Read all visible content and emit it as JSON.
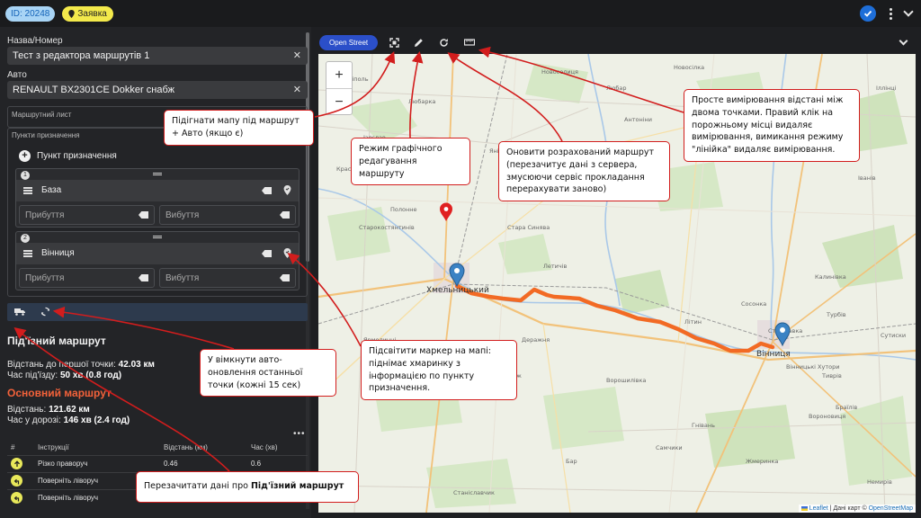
{
  "header": {
    "id_chip": "ID: 20248",
    "status_chip": "Заявка"
  },
  "form": {
    "name_label": "Назва/Номер",
    "name_value": "Тест з редактора маршрутів 1",
    "car_label": "Авто",
    "car_value": "RENAULT BX2301CE Dokker снабж",
    "waybill_label": "Маршрутний лист",
    "destinations_label": "Пункти призначення",
    "add_destination": "Пункт призначення",
    "arrival_placeholder": "Прибуття",
    "departure_placeholder": "Вибуття",
    "stops": [
      {
        "num": "1",
        "name": "База"
      },
      {
        "num": "2",
        "name": "Вінниця"
      }
    ]
  },
  "approach": {
    "title": "Під'їзний маршрут",
    "dist_label": "Відстань до першої точки:",
    "dist_value": "42.03 км",
    "time_label": "Час під'їзду:",
    "time_value": "50 хв (0.8 год)"
  },
  "main_route": {
    "title": "Основний маршрут",
    "dist_label": "Відстань:",
    "dist_value": "121.62 км",
    "time_label": "Час у дорозі:",
    "time_value": "146 хв (2.4 год)"
  },
  "instructions": {
    "headers": [
      "#",
      "Інструкції",
      "Відстань (км)",
      "Час (хв)"
    ],
    "rows": [
      {
        "icon": "arrow-up-icon",
        "text": "Різко праворуч",
        "dist": "0.46",
        "time": "0.6"
      },
      {
        "icon": "turn-left-icon",
        "text": "Поверніть ліворуч",
        "dist": "",
        "time": ""
      },
      {
        "icon": "turn-left-icon",
        "text": "Поверніть ліворуч",
        "dist": "",
        "time": ""
      }
    ]
  },
  "map": {
    "layer_button": "Open Street",
    "attribution_leaflet": "Leaflet",
    "attribution_mid": " | Дані карт © ",
    "attribution_osm": "OpenStreetMap",
    "labels": [
      "Новосілка",
      "Новоселиця",
      "Антоніни",
      "Стара Синява",
      "Хмельницький",
      "Вінниця",
      "Деражня",
      "Літин",
      "Стрижавка",
      "Турбів",
      "Калинівка",
      "Вороновиця",
      "Немирів",
      "Хмільник",
      "Летичів",
      "Меджибіж",
      "Старокостянтинів",
      "Ізяслав",
      "Любар",
      "Любарка",
      "Кам'янка",
      "Ярмолинці",
      "Бар",
      "Жмеринка",
      "Тиврів",
      "Вінницькі Хутори",
      "Сосонка",
      "Красилів",
      "Теофіполь",
      "Острополь",
      "Самчики",
      "Полонне",
      "Янів",
      "Гнівань",
      "Іванів",
      "Браїлів",
      "Станіславчик",
      "Сутиски",
      "Ворошилівка",
      "Пиків",
      "Іллінці"
    ],
    "route_color": "#f26a24",
    "marker_color": "#3b82c4",
    "red_marker_color": "#e02020"
  },
  "callouts": {
    "fit": "Підігнати мапу під маршрут + Авто (якщо є)",
    "edit": "Режим графічного редагування маршруту",
    "refresh": "Оновити розрахований маршрут (перезачитує дані з сервера, змусюючи сервіс прокладання перерахувати заново)",
    "measure": "Просте вимірювання відстані між двома точками. Правий клік на порожньому місці видаляє вимірювання, вимикання режиму \"лінійка\" видаляє вимірювання.",
    "autoupdate": "У вімкнути авто-оновлення останньої точки (кожні 15 сек)",
    "highlight": "Підсвітити маркер на мапі: піднімає хмаринку з інформацією по пункту призначення.",
    "reload_prefix": "Перезачитати дані про ",
    "reload_bold": "Під'їзний маршрут"
  }
}
